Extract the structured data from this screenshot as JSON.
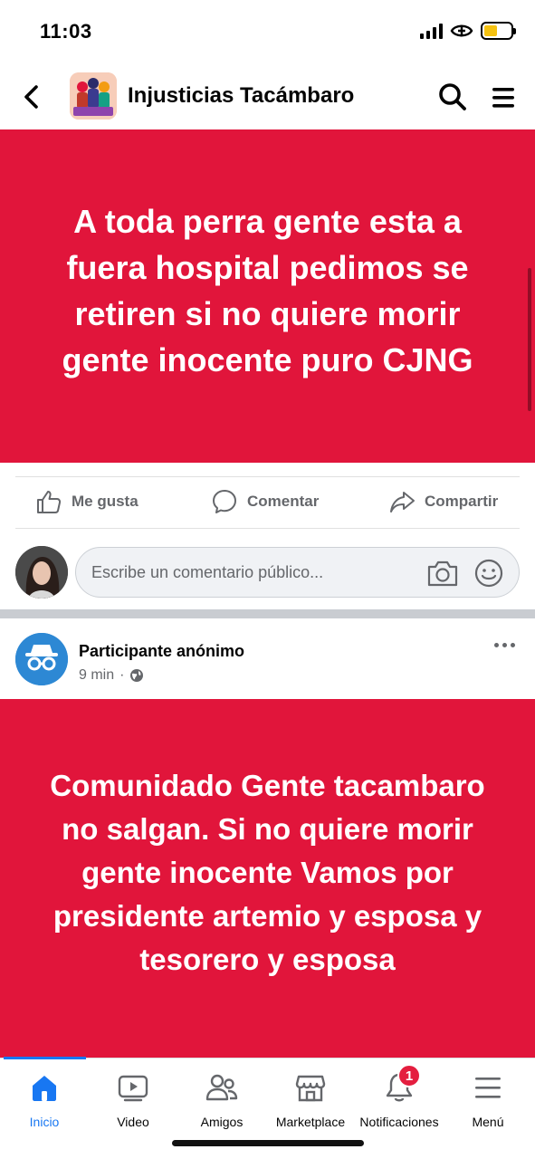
{
  "status_bar": {
    "time": "11:03",
    "battery_level": 0.5
  },
  "header": {
    "group_name": "Injusticias Tacámbaro",
    "back_icon": "chevron-left-icon",
    "search_icon": "search-icon",
    "menu_icon": "hamburger-icon"
  },
  "post1": {
    "text": "A toda perra gente esta a fuera hospital pedimos se retiren si no quiere morir gente inocente puro CJNG",
    "background_color": "#e1153b"
  },
  "actions": {
    "like": "Me gusta",
    "comment": "Comentar",
    "share": "Compartir"
  },
  "comment_box": {
    "placeholder": "Escribe un comentario público..."
  },
  "post2": {
    "author": "Participante anónimo",
    "time": "9 min",
    "separator": "·",
    "audience_icon": "globe-icon",
    "text": "Comunidado Gente tacambaro no salgan. Si no quiere morir gente inocente Vamos por presidente artemio y esposa y tesorero y esposa",
    "background_color": "#e1153b"
  },
  "bottom_nav": {
    "items": [
      {
        "label": "Inicio",
        "icon": "home-icon",
        "active": true
      },
      {
        "label": "Video",
        "icon": "video-icon",
        "active": false
      },
      {
        "label": "Amigos",
        "icon": "friends-icon",
        "active": false
      },
      {
        "label": "Marketplace",
        "icon": "marketplace-icon",
        "active": false
      },
      {
        "label": "Notificaciones",
        "icon": "bell-icon",
        "active": false,
        "badge": "1"
      },
      {
        "label": "Menú",
        "icon": "menu-icon",
        "active": false
      }
    ],
    "accent_color": "#1877f2"
  }
}
